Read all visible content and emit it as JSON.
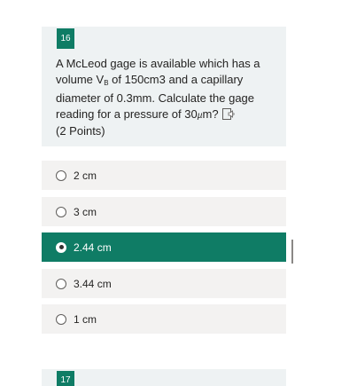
{
  "question": {
    "number": "16",
    "text": "A McLeod gage is available which has a volume V",
    "subscript": "B",
    "text_after": " of 150cm3 and a capillary diameter of 0.3mm. Calculate the gage reading for a pressure of 30",
    "unit_glyph": "µ",
    "text_end": "m?",
    "points": "(2 Points)",
    "speaker_icon": "speaker-icon"
  },
  "options": [
    {
      "label": "2 cm",
      "selected": false
    },
    {
      "label": "3 cm",
      "selected": false
    },
    {
      "label": "2.44 cm",
      "selected": true
    },
    {
      "label": "3.44 cm",
      "selected": false
    },
    {
      "label": "1 cm",
      "selected": false
    }
  ],
  "next_question": {
    "number": "17"
  },
  "colors": {
    "accent": "#0f7c65",
    "card_bg": "#eef2f3",
    "option_bg": "#f3f2f1"
  }
}
